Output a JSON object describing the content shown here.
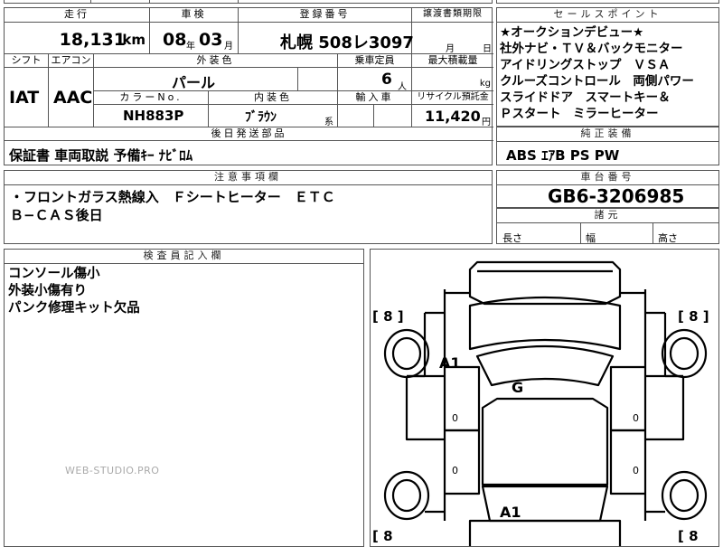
{
  "header": {
    "mileage_label": "走行",
    "inspection_label": "車検",
    "registration_label": "登録番号",
    "transfer_label": "譲渡書類期限",
    "mileage_value": "18,131",
    "mileage_unit": "km",
    "inspection_year": "08",
    "inspection_year_unit": "年",
    "inspection_month": "03",
    "inspection_month_unit": "月",
    "registration_value": "札幌 508レ3097",
    "transfer_month": "月",
    "transfer_day": "日"
  },
  "specs": {
    "shift_label": "シフト",
    "aircon_label": "エアコン",
    "exterior_color_label": "外装色",
    "capacity_label": "乗車定員",
    "max_load_label": "最大積載量",
    "shift_value": "IAT",
    "aircon_value": "AAC",
    "exterior_color_value": "パール",
    "capacity_value": "6",
    "capacity_unit": "人",
    "max_load_unit": "kg",
    "color_no_label": "カラーNo.",
    "interior_color_label": "内装色",
    "import_label": "輸入車",
    "recycle_label": "リサイクル預託金",
    "color_no_value": "NH883P",
    "interior_color_value": "ﾌﾞﾗｳﾝ",
    "interior_color_suffix": "系",
    "recycle_value": "11,420",
    "recycle_unit": "円"
  },
  "later_parts": {
    "label": "後日発送部品",
    "value": "保証書 車両取説 予備ｷｰ ﾅﾋﾞﾛﾑ"
  },
  "notes": {
    "label": "注意事項欄",
    "lines": [
      "・フロントガラス熱線入　Ｆシートヒーター　ＥＴＣ",
      "Ｂ−ＣＡＳ後日"
    ]
  },
  "selling_points": {
    "label": "セールスポイント",
    "lines": [
      "★オークションデビュー★",
      "社外ナビ・ＴＶ＆バックモニター",
      "アイドリングストップ　ＶＳＡ",
      "クルーズコントロール　両側パワー",
      "スライドドア　スマートキー＆",
      "Ｐスタート　ミラーヒーター"
    ]
  },
  "standard_equipment": {
    "label": "純正装備",
    "value": "ABS ｴｱB PS PW"
  },
  "chassis": {
    "label": "車台番号",
    "value": "GB6-3206985"
  },
  "dimensions": {
    "label": "諸元",
    "length_label": "長さ",
    "width_label": "幅",
    "height_label": "高さ"
  },
  "inspector": {
    "label": "検査員記入欄",
    "lines": [
      "コンソール傷小",
      "外装小傷有り",
      "パンク修理キット欠品"
    ]
  },
  "diagram": {
    "tire_labels": [
      "[ 8 ]",
      "[ 8 ]",
      "[ 8",
      "[ 8"
    ],
    "marks": [
      "A1",
      "G",
      "A1"
    ],
    "zero_marks": [
      "0",
      "0",
      "0",
      "0"
    ]
  },
  "watermark": "WEB-STUDIO.PRO"
}
